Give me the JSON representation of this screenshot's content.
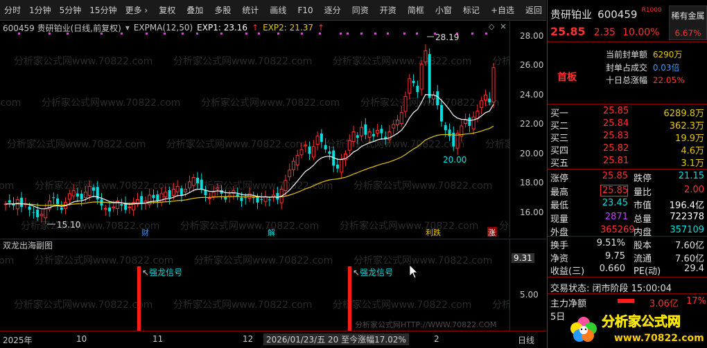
{
  "toolbar": {
    "items": [
      "分时",
      "1分钟",
      "5分钟",
      "15分钟",
      "更多 ›",
      "复权",
      "叠加",
      "多股",
      "统计",
      "画线",
      "F10",
      "逐分",
      "同资",
      "开资",
      "简框",
      "小窗",
      "标记",
      "+自选"
    ],
    "back": "返回"
  },
  "chart_head": {
    "code_name": "600459 贵研铂业(日线,前复权)",
    "indicator": "EXPMA(12,50)",
    "exp1": "EXP1: 23.16",
    "exp2": "EXP2: 21.37",
    "up_arrow": "↑"
  },
  "annotations": {
    "high_label": "28.19",
    "mid_low_label": "20.00",
    "low_label": "15.10",
    "markers": [
      "财",
      "解",
      "利跌",
      "涨"
    ]
  },
  "watermark": "分析家公式网www.70822.com",
  "sub_chart": {
    "title": "双龙出海副图",
    "signals": [
      "强龙信号",
      "强龙信号"
    ],
    "watermark2": "分析家公式网HTTP://WWW.70822.COM"
  },
  "price_axis": [
    "28.00",
    "26.00",
    "24.00",
    "22.00",
    "20.00",
    "18.00",
    "16.00"
  ],
  "sub_axis": [
    "9.31",
    "5.00"
  ],
  "time_axis": {
    "labels": [
      "2025年",
      "10",
      "11",
      "12",
      "2"
    ],
    "date_box": "2026/01/23/五 20 至今涨幅17.02%",
    "right": "日线"
  },
  "panel": {
    "stock_name": "贵研铂业",
    "stock_code": "600459",
    "r_badge": "R1000",
    "price": "25.85",
    "change": "2.35",
    "change_pct": "10.00%",
    "rare": {
      "label": "稀有金属",
      "value": "6.67%"
    },
    "seal": [
      {
        "label": "当前封单额",
        "value": "6290万"
      },
      {
        "label": "封单占成交",
        "value": "0.03倍"
      },
      {
        "label": "十日总涨幅",
        "value": "22.05%"
      }
    ],
    "first_board": "首板",
    "orders": [
      {
        "label": "买一",
        "price": "25.85",
        "vol": "6289.8万"
      },
      {
        "label": "买二",
        "price": "25.84",
        "vol": "362.3万"
      },
      {
        "label": "买三",
        "price": "25.83",
        "vol": "19.9万"
      },
      {
        "label": "买四",
        "price": "25.82",
        "vol": "4.6万"
      },
      {
        "label": "买五",
        "price": "25.81",
        "vol": "3.1万"
      }
    ],
    "stats": [
      {
        "l1": "涨停",
        "v1": "25.85",
        "c1": "red",
        "l2": "跌停",
        "v2": "21.15",
        "c2": "green"
      },
      {
        "l1": "最高",
        "v1": "25.85",
        "c1": "red",
        "l2": "量比",
        "v2": "2.00",
        "c2": "red"
      },
      {
        "l1": "最低",
        "v1": "23.45",
        "c1": "green",
        "l2": "市值",
        "v2": "196.4亿",
        "c2": "white"
      },
      {
        "l1": "现量",
        "v1": "2871",
        "c1": "purple",
        "l2": "总量",
        "v2": "722378",
        "c2": "white"
      },
      {
        "l1": "外盘",
        "v1": "365269",
        "c1": "red",
        "l2": "内盘",
        "v2": "357109",
        "c2": "green"
      }
    ],
    "stats2": [
      {
        "l1": "换手",
        "v1": "9.51%",
        "l2": "股本",
        "v2": "7.60亿"
      },
      {
        "l1": "净资",
        "v1": "9.75",
        "l2": "流通",
        "v2": "7.60亿"
      },
      {
        "l1": "收益(三)",
        "v1": "0.660",
        "l2": "PE(动)",
        "v2": "29.4"
      }
    ],
    "trade_status": "交易状态: 闭市阶段 15:00:04",
    "main_flow": {
      "label": "主力净额",
      "value": "3.06亿",
      "pct": "17%"
    },
    "five_day": "5日"
  },
  "logo": {
    "text": "分析家公式网",
    "url": "www.70822.com"
  },
  "colors": {
    "up": "#ff3030",
    "down": "#00e0e0",
    "ma1": "#ffffff",
    "ma2": "#e8c800"
  }
}
